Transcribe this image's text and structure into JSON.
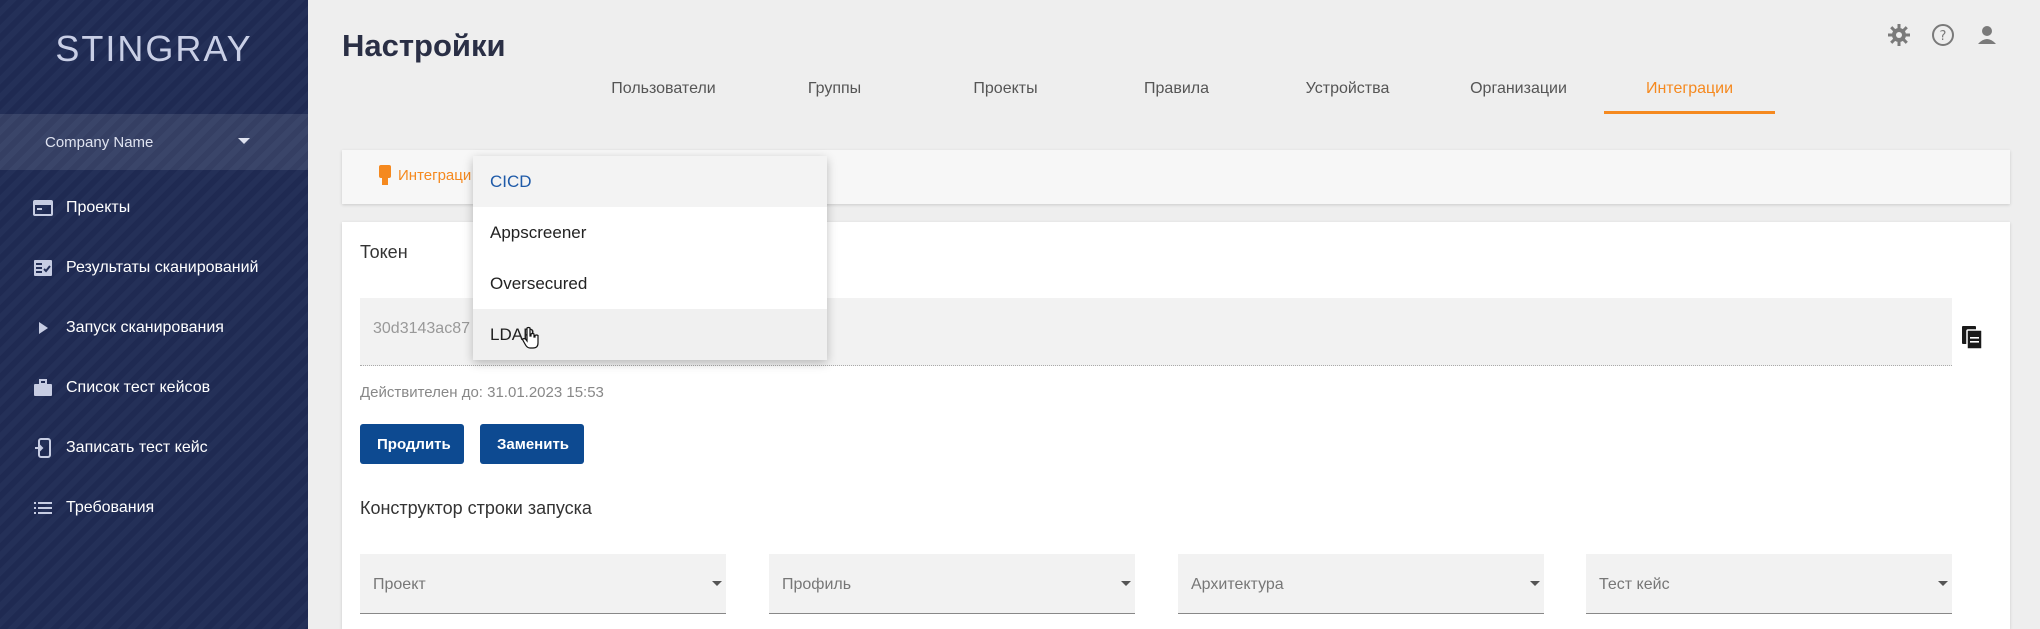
{
  "sidebar": {
    "logo": "STINGRAY",
    "company": "Company Name",
    "items": [
      {
        "label": "Проекты",
        "icon": "projects-icon"
      },
      {
        "label": "Результаты сканирований",
        "icon": "scan-results-icon"
      },
      {
        "label": "Запуск сканирования",
        "icon": "play-icon"
      },
      {
        "label": "Список тест кейсов",
        "icon": "briefcase-icon"
      },
      {
        "label": "Записать тест кейс",
        "icon": "record-device-icon"
      },
      {
        "label": "Требования",
        "icon": "list-icon"
      }
    ]
  },
  "header": {
    "title": "Настройки",
    "icons": [
      "gear-icon",
      "help-icon",
      "user-icon"
    ]
  },
  "tabs": [
    {
      "label": "Пользователи",
      "active": false
    },
    {
      "label": "Группы",
      "active": false
    },
    {
      "label": "Проекты",
      "active": false
    },
    {
      "label": "Правила",
      "active": false
    },
    {
      "label": "Устройства",
      "active": false
    },
    {
      "label": "Организации",
      "active": false
    },
    {
      "label": "Интеграции",
      "active": true
    }
  ],
  "integration_tab": {
    "label": "Интеграци"
  },
  "token": {
    "label": "Токен",
    "value": "30d3143ac87",
    "valid_until": "Действителен до: 31.01.2023 15:53"
  },
  "buttons": {
    "extend": "Продлить",
    "replace": "Заменить"
  },
  "constructor": {
    "label": "Конструктор строки запуска",
    "selects": [
      {
        "placeholder": "Проект"
      },
      {
        "placeholder": "Профиль"
      },
      {
        "placeholder": "Архитектура"
      },
      {
        "placeholder": "Тест кейс"
      }
    ]
  },
  "dropdown": {
    "items": [
      {
        "label": "CICD",
        "state": "selected"
      },
      {
        "label": "Appscreener",
        "state": "normal"
      },
      {
        "label": "Oversecured",
        "state": "normal"
      },
      {
        "label": "LDAP",
        "state": "hover"
      }
    ]
  },
  "colors": {
    "accent": "#f5891f",
    "primary": "#0d4a91",
    "sidebar": "#1f2a52",
    "selected_text": "#1e5aa8"
  }
}
